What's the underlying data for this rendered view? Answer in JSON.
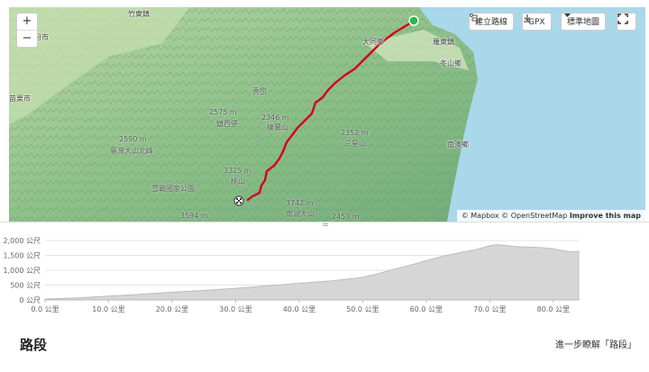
{
  "map": {
    "zoom_in": "+",
    "zoom_out": "−",
    "buttons": {
      "create_route": "建立路線",
      "gpx": "GPX",
      "map_style": "標準地圖"
    },
    "icons": [
      "route-icon",
      "download-icon",
      "caret-down-icon",
      "fullscreen-icon",
      "start-marker-icon",
      "finish-flag-icon"
    ],
    "colors": {
      "route": "#d6001c",
      "start": "#1fbf3f",
      "terrain": "#7fb77e",
      "water": "#a8d8ea"
    },
    "places": [
      "竹東鎮",
      "頭份市",
      "苗栗市",
      "大同鄉",
      "羅東鎮",
      "冬山鄉",
      "南澳鄉"
    ],
    "peaks": [
      "2575 m",
      "2346 m",
      "2590 m",
      "2352 m",
      "3325 m",
      "3742 m",
      "3594 m",
      "2453 m"
    ],
    "feature_labels": [
      "秀巒",
      "臺灣大山北峰",
      "雪霸國家公園",
      "棲蘭山",
      "桃山",
      "三星山",
      "南湖大山",
      "鎮西堡"
    ],
    "attribution": {
      "mapbox": "© Mapbox",
      "osm": "© OpenStreetMap",
      "improve": "Improve this map"
    }
  },
  "chart_data": {
    "type": "area",
    "title": "",
    "xlabel": "",
    "ylabel": "",
    "x_ticks": [
      "0.0 公里",
      "10.0 公里",
      "20.0 公里",
      "30.0 公里",
      "40.0 公里",
      "50.0 公里",
      "60.0 公里",
      "70.0 公里",
      "80.0 公里"
    ],
    "y_ticks": [
      "0 公尺",
      "500 公尺",
      "1,000 公尺",
      "1,500 公尺",
      "2,000 公尺"
    ],
    "xlim": [
      0,
      84
    ],
    "ylim": [
      0,
      2000
    ],
    "grid": true,
    "fill_color": "#d6d6d6",
    "line_color": "#bdbdbd",
    "series": [
      {
        "x": [
          0,
          5,
          10,
          15,
          20,
          25,
          30,
          35,
          40,
          45,
          50,
          52,
          55,
          58,
          60,
          62,
          65,
          68,
          70,
          71,
          72,
          74,
          76,
          78,
          80,
          82,
          83,
          84
        ],
        "y": [
          30,
          70,
          130,
          190,
          260,
          320,
          390,
          480,
          560,
          640,
          760,
          860,
          1040,
          1200,
          1320,
          1440,
          1580,
          1700,
          1820,
          1860,
          1840,
          1800,
          1780,
          1760,
          1720,
          1640,
          1620,
          1640
        ]
      }
    ]
  },
  "segments": {
    "title": "路段",
    "learn_more": "進一步瞭解「路段」"
  }
}
